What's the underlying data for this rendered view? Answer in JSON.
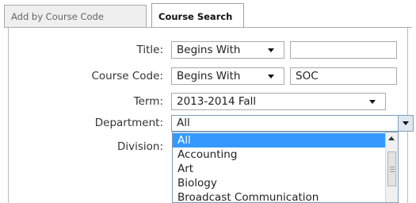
{
  "tabs": [
    {
      "label": "Add by Course Code",
      "active": false
    },
    {
      "label": "Course Search",
      "active": true
    }
  ],
  "form": {
    "title": {
      "label": "Title:",
      "mode": "Begins With",
      "value": ""
    },
    "course_code": {
      "label": "Course Code:",
      "mode": "Begins With",
      "value": "SOC"
    },
    "term": {
      "label": "Term:",
      "value": "2013-2014 Fall"
    },
    "department": {
      "label": "Department:",
      "value": "All"
    },
    "division": {
      "label": "Division:"
    }
  },
  "department_options": [
    "All",
    "Accounting",
    "Art",
    "Biology",
    "Broadcast Communication"
  ],
  "icons": {
    "dropdown": "chevron-down-icon",
    "scroll_up": "scroll-up-icon"
  },
  "colors": {
    "selection": "#3399ff",
    "border": "#a9a9a9",
    "focus_border": "#7f9db9"
  }
}
